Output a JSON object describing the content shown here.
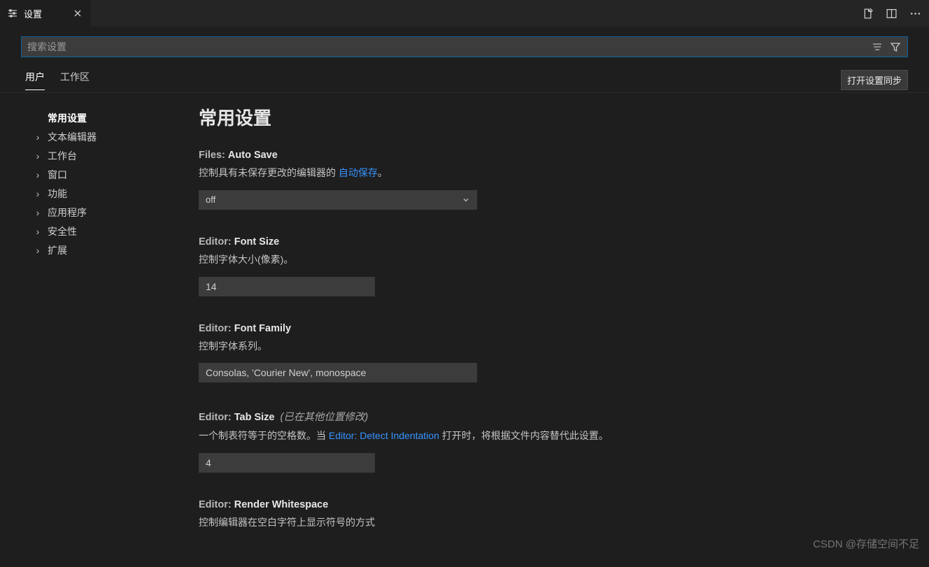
{
  "tab": {
    "title": "设置"
  },
  "search": {
    "placeholder": "搜索设置"
  },
  "scope": {
    "tabs": [
      "用户",
      "工作区"
    ],
    "syncButton": "打开设置同步"
  },
  "toc": {
    "items": [
      {
        "label": "常用设置",
        "active": true,
        "expandable": false
      },
      {
        "label": "文本编辑器",
        "active": false,
        "expandable": true
      },
      {
        "label": "工作台",
        "active": false,
        "expandable": true
      },
      {
        "label": "窗口",
        "active": false,
        "expandable": true
      },
      {
        "label": "功能",
        "active": false,
        "expandable": true
      },
      {
        "label": "应用程序",
        "active": false,
        "expandable": true
      },
      {
        "label": "安全性",
        "active": false,
        "expandable": true
      },
      {
        "label": "扩展",
        "active": false,
        "expandable": true
      }
    ]
  },
  "section": {
    "title": "常用设置"
  },
  "settings": {
    "autoSave": {
      "cat": "Files: ",
      "name": "Auto Save",
      "desc_before": "控制具有未保存更改的编辑器的 ",
      "desc_link": "自动保存",
      "desc_after": "。",
      "value": "off"
    },
    "fontSize": {
      "cat": "Editor: ",
      "name": "Font Size",
      "desc": "控制字体大小(像素)。",
      "value": "14"
    },
    "fontFamily": {
      "cat": "Editor: ",
      "name": "Font Family",
      "desc": "控制字体系列。",
      "value": "Consolas, 'Courier New', monospace"
    },
    "tabSize": {
      "cat": "Editor: ",
      "name": "Tab Size",
      "hint": "(已在其他位置修改)",
      "desc_before": "一个制表符等于的空格数。当 ",
      "desc_link": "Editor: Detect Indentation",
      "desc_after": " 打开时，将根据文件内容替代此设置。",
      "value": "4"
    },
    "renderWhitespace": {
      "cat": "Editor: ",
      "name": "Render Whitespace",
      "desc": "控制编辑器在空白字符上显示符号的方式"
    }
  },
  "watermark": "CSDN @存储空间不足"
}
